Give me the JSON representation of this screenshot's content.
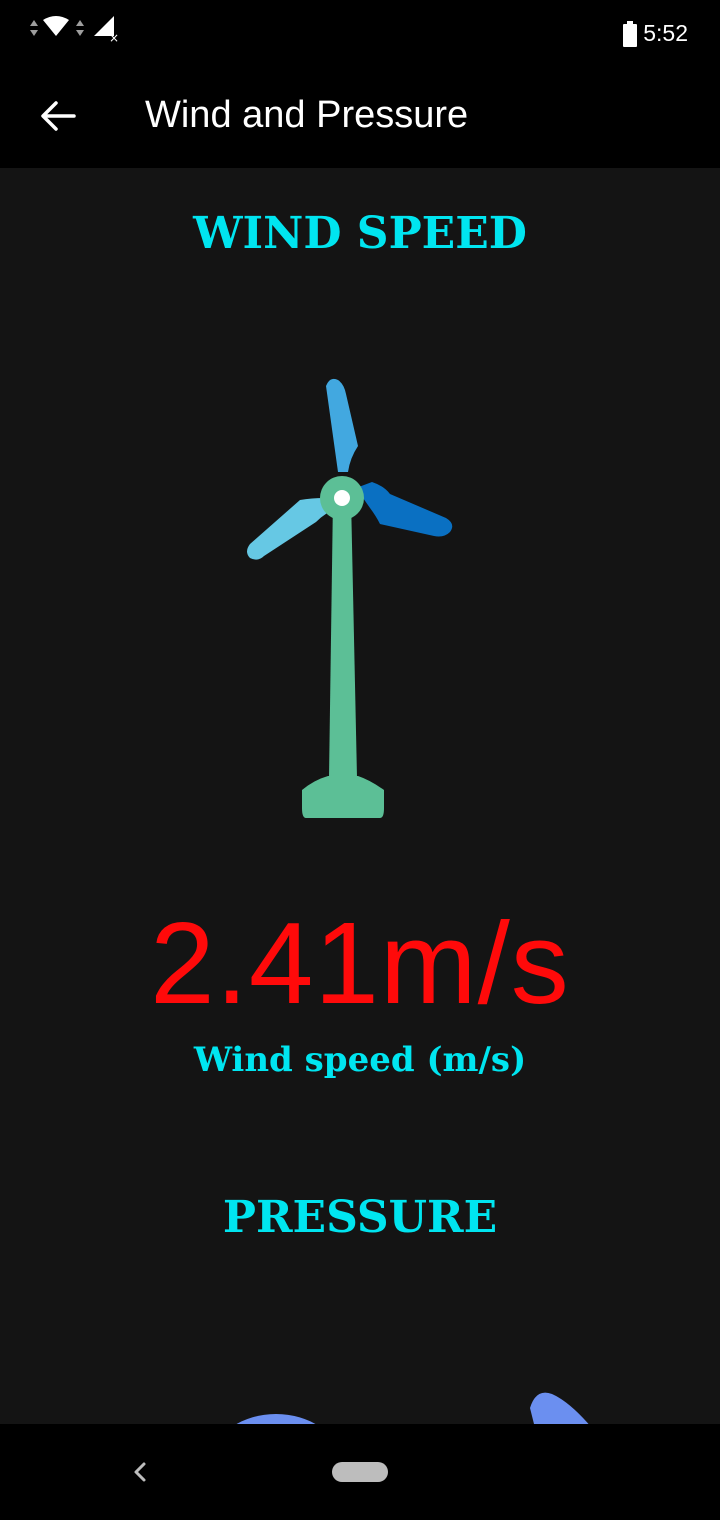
{
  "status_bar": {
    "time": "5:52",
    "icons": [
      "data-arrows-icon",
      "wifi-icon",
      "data-arrows-icon",
      "signal-no-service-icon",
      "battery-icon"
    ]
  },
  "app_bar": {
    "back_icon": "arrow-left-icon",
    "title": "Wind and Pressure"
  },
  "wind": {
    "heading": "WIND SPEED",
    "value": "2.41m/s",
    "label": "Wind speed (m/s)",
    "illustration": "wind-turbine-icon"
  },
  "pressure": {
    "heading": "PRESSURE",
    "illustration": "pressure-gauge"
  },
  "colors": {
    "heading": "#00e5f0",
    "value": "#ff0a0a",
    "turbine_tower": "#5cbf96",
    "blade_top": "#42a8e0",
    "blade_left": "#66c8e4",
    "blade_right": "#0a70c2",
    "gauge": "#6b8ff0",
    "background": "#141414"
  },
  "nav_bar": {
    "back_icon": "nav-back-icon",
    "home_icon": "nav-home-pill"
  }
}
